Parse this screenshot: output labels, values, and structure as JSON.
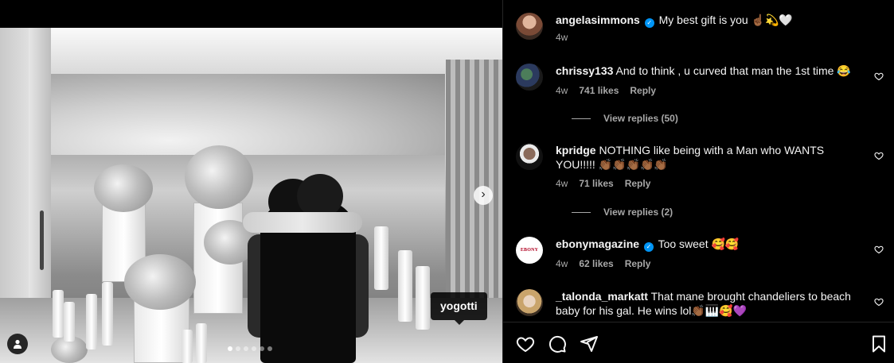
{
  "post": {
    "author": "angelasimmons",
    "caption": "My best gift is you ☝🏾💫🤍",
    "age": "4w"
  },
  "photo_tag": {
    "label": "yogotti"
  },
  "carousel": {
    "count": 6,
    "active_index": 0
  },
  "comments": [
    {
      "user": "chrissy133",
      "verified": false,
      "text": "And to think , u curved that man the 1st time 😂",
      "age": "4w",
      "likes": "741 likes",
      "reply": "Reply",
      "view_replies": "View replies (50)"
    },
    {
      "user": "kpridge",
      "verified": false,
      "text": "NOTHING like being with a Man who WANTS YOU!!!!! 👏🏾👏🏾👏🏾👏🏾👏🏾",
      "age": "4w",
      "likes": "71 likes",
      "reply": "Reply",
      "view_replies": "View replies (2)"
    },
    {
      "user": "ebonymagazine",
      "verified": true,
      "text": "Too sweet 🥰🥰",
      "age": "4w",
      "likes": "62 likes",
      "reply": "Reply",
      "avatar_text": "EBONY"
    },
    {
      "user": "_talonda_markatt",
      "verified": false,
      "text": "That mane brought chandeliers to beach baby for his gal. He wins lol👏🏾🎹🥰💜"
    }
  ],
  "icons": {
    "like": "heart-icon",
    "comment": "comment-icon",
    "share": "share-icon",
    "save": "bookmark-icon",
    "next": "chevron-right-icon",
    "tags": "user-tag-icon",
    "verified": "verified-badge-icon"
  },
  "colors": {
    "background": "#000000",
    "text": "#f5f5f5",
    "secondary": "#a8a8a8",
    "verified": "#0095f6",
    "divider": "#262626"
  }
}
